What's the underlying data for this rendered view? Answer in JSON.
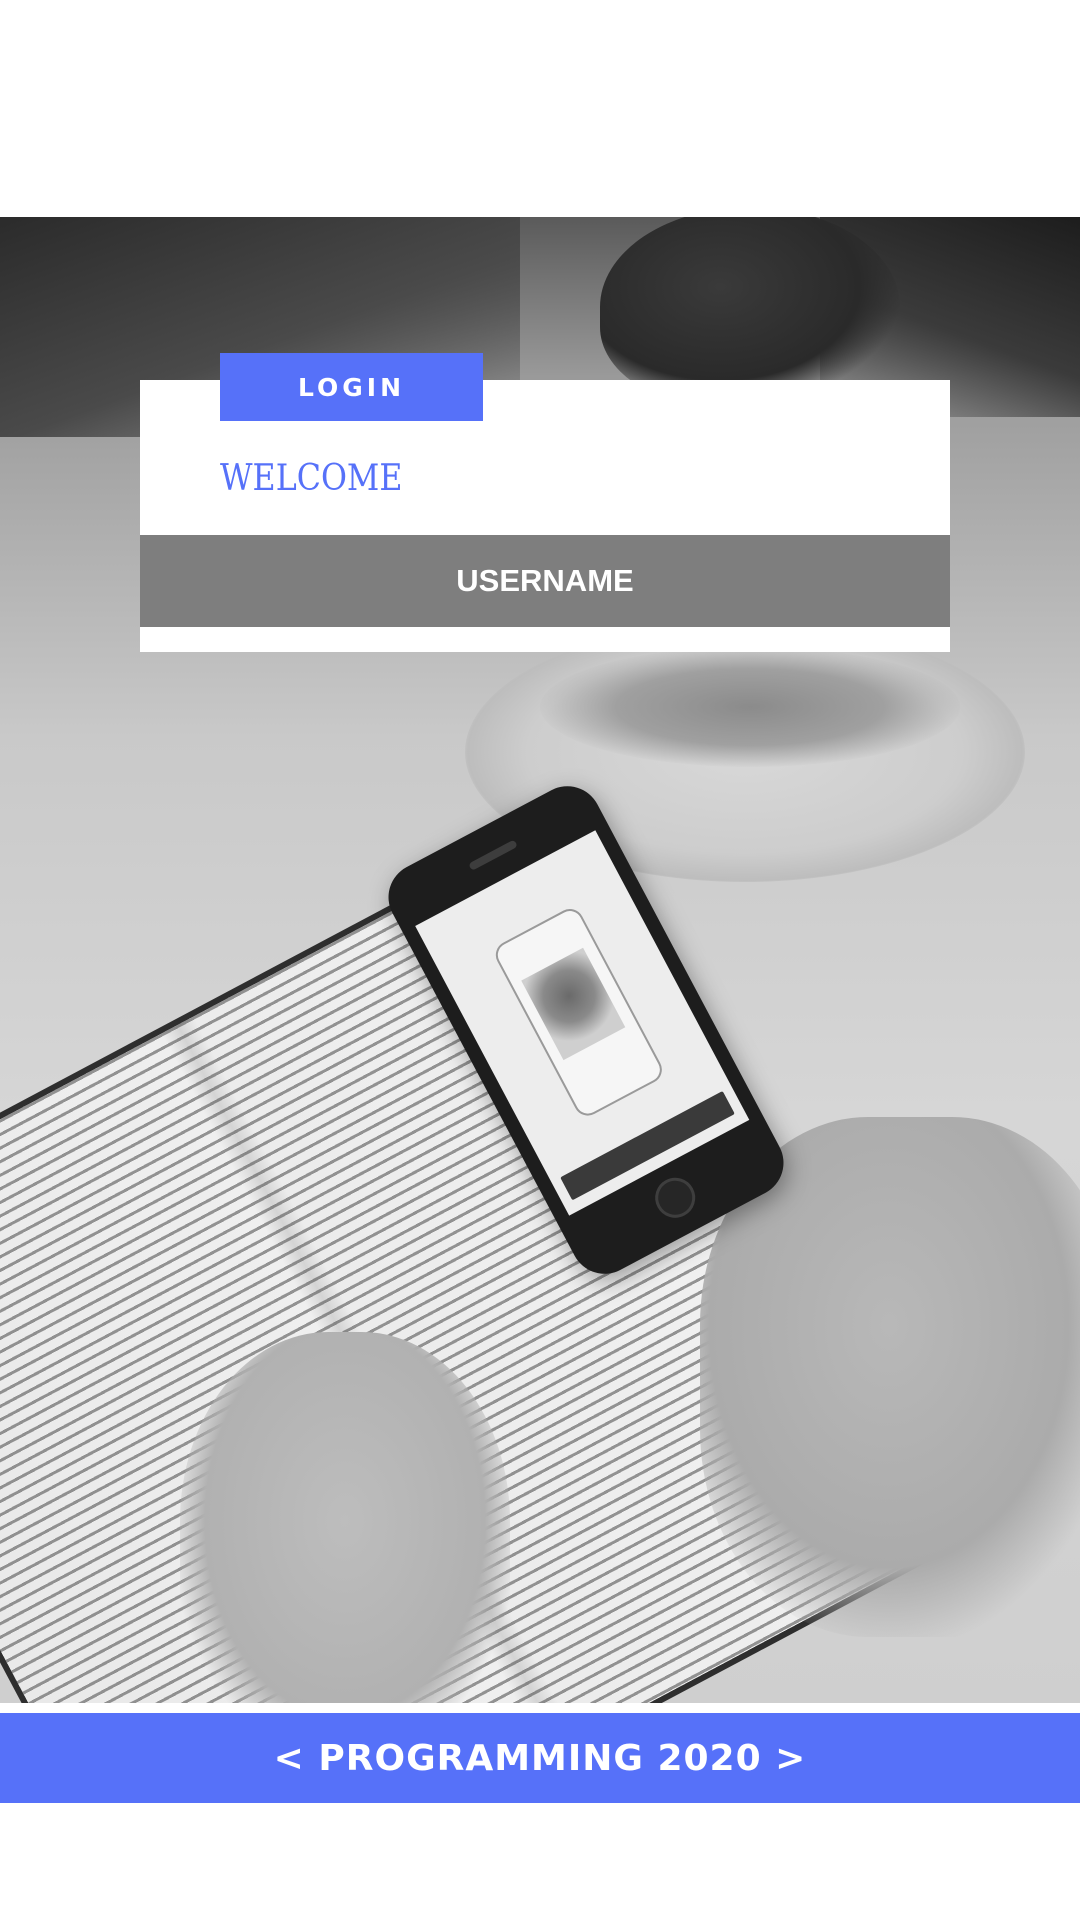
{
  "login": {
    "tab_label": "LOGIN",
    "welcome": "WELCOME",
    "username_placeholder": "USERNAME"
  },
  "banner": {
    "text": "< PROGRAMMING 2020 >"
  },
  "colors": {
    "accent": "#5671f9",
    "field": "#7e7e7e",
    "card": "#ffffff"
  },
  "icons": {
    "background": "desk-photo-with-phone-and-book"
  }
}
